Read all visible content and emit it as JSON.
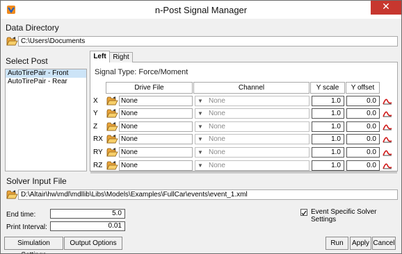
{
  "window": {
    "title": "n-Post Signal Manager",
    "close_label": "✕",
    "app_icon": "logo-icon"
  },
  "data_directory": {
    "label": "Data Directory",
    "path": "C:\\Users\\Documents"
  },
  "select_post": {
    "label": "Select Post",
    "items": [
      {
        "label": "AutoTirePair - Front",
        "selected": true
      },
      {
        "label": "AutoTirePair - Rear",
        "selected": false
      }
    ]
  },
  "tabs": [
    {
      "label": "Left",
      "active": true
    },
    {
      "label": "Right",
      "active": false
    }
  ],
  "signal_panel": {
    "signal_type": "Signal Type: Force/Moment",
    "columns": {
      "drive_file": "Drive File",
      "channel": "Channel",
      "y_scale": "Y scale",
      "y_offset": "Y offset"
    },
    "rows": [
      {
        "label": "X",
        "drive_file": "None",
        "channel": "None",
        "y_scale": "1.0",
        "y_offset": "0.0"
      },
      {
        "label": "Y",
        "drive_file": "None",
        "channel": "None",
        "y_scale": "1.0",
        "y_offset": "0.0"
      },
      {
        "label": "Z",
        "drive_file": "None",
        "channel": "None",
        "y_scale": "1.0",
        "y_offset": "0.0"
      },
      {
        "label": "RX",
        "drive_file": "None",
        "channel": "None",
        "y_scale": "1.0",
        "y_offset": "0.0"
      },
      {
        "label": "RY",
        "drive_file": "None",
        "channel": "None",
        "y_scale": "1.0",
        "y_offset": "0.0"
      },
      {
        "label": "RZ",
        "drive_file": "None",
        "channel": "None",
        "y_scale": "1.0",
        "y_offset": "0.0"
      }
    ]
  },
  "solver_input": {
    "label": "Solver Input File",
    "path": "D:\\Altair\\hw\\mdl\\mdllib\\Libs\\Models\\Examples\\FullCar\\events\\event_1.xml"
  },
  "settings": {
    "end_time_label": "End time:",
    "end_time": "5.0",
    "print_interval_label": "Print Interval:",
    "print_interval": "0.01",
    "event_specific_label": "Event Specific Solver Settings",
    "event_specific_checked": true
  },
  "buttons": {
    "simulation_settings": "Simulation Settings",
    "output_options": "Output Options",
    "run": "Run",
    "apply": "Apply",
    "cancel": "Cancel"
  },
  "colors": {
    "selection": "#cce4f7",
    "close": "#c7372f",
    "folder": "#e9a43a",
    "plot_curve": "#d01818"
  }
}
